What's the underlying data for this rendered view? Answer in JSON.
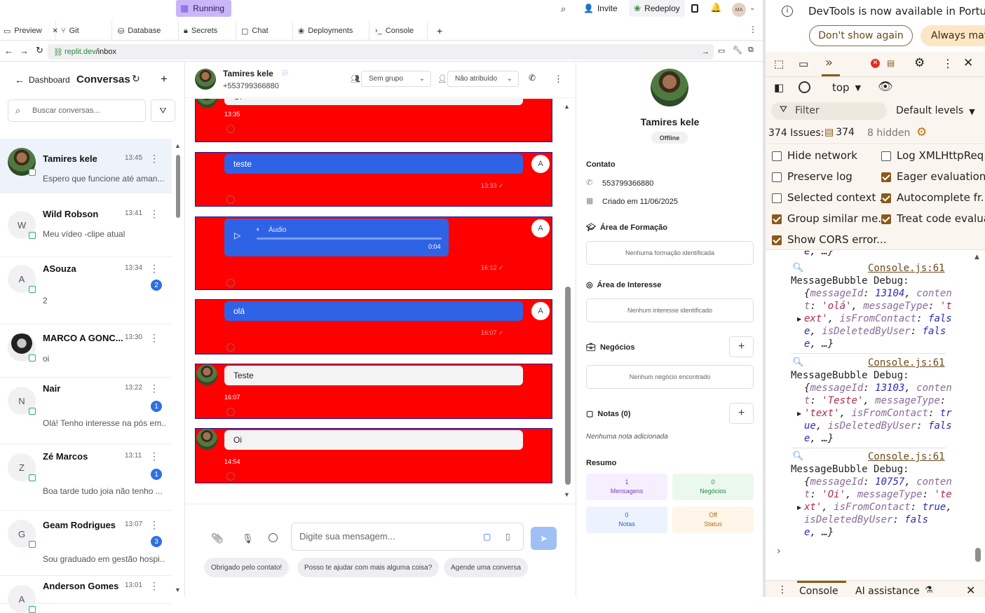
{
  "replit": {
    "status": "Running",
    "invite": "Invite",
    "redeploy": "Redeploy",
    "user_initials": "MA",
    "tabs": [
      "Preview",
      "Git",
      "Database",
      "Secrets",
      "Chat",
      "Deployments",
      "Console"
    ],
    "url_host": "replit.dev",
    "url_path": "/inbox"
  },
  "sidebar": {
    "back_label": "Dashboard",
    "title": "Conversas",
    "search_placeholder": "Buscar conversas...",
    "conversations": [
      {
        "name": "Tamires kele",
        "time": "13:45",
        "preview": "Espero que funcione até aman...",
        "avatar": "photo",
        "badge": ""
      },
      {
        "name": "Wild Robson",
        "time": "13:41",
        "preview": "Meu vídeo -clipe atual",
        "avatar": "W",
        "badge": ""
      },
      {
        "name": "ASouza",
        "time": "13:34",
        "preview": "2",
        "avatar": "A",
        "badge": "2"
      },
      {
        "name": "MARCO A GONC...",
        "time": "13:30",
        "preview": "oi",
        "avatar": "photo2",
        "badge": ""
      },
      {
        "name": "Nair",
        "time": "13:22",
        "preview": "Olá! Tenho interesse na pós em...",
        "avatar": "N",
        "badge": "1"
      },
      {
        "name": "Zé Marcos",
        "time": "13:11",
        "preview": "Boa tarde tudo joia não tenho ...",
        "avatar": "Z",
        "badge": "1"
      },
      {
        "name": "Geam Rodrigues",
        "time": "13:07",
        "preview": "Sou graduado em gestão hospi...",
        "avatar": "G",
        "badge": "3"
      },
      {
        "name": "Anderson Gomes",
        "time": "13:01",
        "preview": "",
        "avatar": "A",
        "badge": ""
      }
    ]
  },
  "chat": {
    "contact_name": "Tamires kele",
    "contact_phone": "+553799366880",
    "group_select": "Sem grupo",
    "assign_select": "Não atribuído",
    "messages": [
      {
        "text": "Oi",
        "time": "13:35"
      },
      {
        "text": "teste",
        "time": "13:33 ✓"
      },
      {
        "text": "Áudio",
        "duration": "0:04",
        "time": "16:12 ✓"
      },
      {
        "text": "olá",
        "time": "16:07 ✓"
      },
      {
        "text": "Teste",
        "time": "16:07"
      },
      {
        "text": "Oi",
        "time": "14:54"
      }
    ],
    "agent_initial": "A",
    "input_placeholder": "Digite sua mensagem...",
    "quick_replies": [
      "Obrigado pelo contato!",
      "Posso te ajudar com mais alguma coisa?",
      "Agende uma conversa"
    ]
  },
  "contact_panel": {
    "name": "Tamires kele",
    "status": "Offline",
    "contact_heading": "Contato",
    "phone": "553799366880",
    "created": "Criado em 11/06/2025",
    "formation_heading": "Área de Formação",
    "formation_empty": "Nenhuma formação identificada",
    "interest_heading": "Área de Interesse",
    "interest_empty": "Nenhum interesse identificado",
    "deals_heading": "Negócios",
    "deals_empty": "Nenhum negócio encontrado",
    "notes_heading": "Notas (0)",
    "notes_empty": "Nenhuma nota adicionada",
    "summary_heading": "Resumo",
    "stats": [
      {
        "value": "1",
        "label": "Mensagens",
        "color": "#7b3fbf",
        "bg": "#f6efff"
      },
      {
        "value": "0",
        "label": "Negócios",
        "color": "#2a8a3a",
        "bg": "#ebf8ee"
      },
      {
        "value": "0",
        "label": "Notas",
        "color": "#2f5fc0",
        "bg": "#ecf3ff"
      },
      {
        "value": "Off",
        "label": "Status",
        "color": "#c06a10",
        "bg": "#fff5e8"
      }
    ]
  },
  "devtools": {
    "banner": "DevTools is now available in Portug",
    "dont_show": "Don't show again",
    "always_match": "Always mat",
    "context": "top",
    "filter_placeholder": "Filter",
    "levels": "Default levels",
    "issues_count": "374 Issues:",
    "issues_icon_count": "374",
    "hidden": "8 hidden",
    "options": [
      {
        "label": "Hide network",
        "checked": false
      },
      {
        "label": "Log XMLHttpReq...",
        "checked": false
      },
      {
        "label": "Preserve log",
        "checked": false
      },
      {
        "label": "Eager evaluation",
        "checked": true
      },
      {
        "label": "Selected context ...",
        "checked": false
      },
      {
        "label": "Autocomplete fr...",
        "checked": true
      },
      {
        "label": "Group similar me...",
        "checked": true
      },
      {
        "label": "Treat code evalua...",
        "checked": true
      },
      {
        "label": "Show CORS error...",
        "checked": true
      }
    ],
    "logs": [
      {
        "source": "Console.js:61",
        "title": "MessageBubble Debug:",
        "lines": [
          {
            "k": "messageId",
            "v": "13104",
            "t": "num",
            "pre": "{",
            "post": ", conten"
          },
          {
            "raw": "t: 'olá', messageType: 't"
          },
          {
            "raw": "ext', isFromContact: fals"
          },
          {
            "raw": "e, isDeletedByUser: fals"
          },
          {
            "raw": "e, …}"
          }
        ]
      },
      {
        "source": "Console.js:61",
        "title": "MessageBubble Debug:",
        "lines": [
          {
            "raw": "{messageId: 13103, conten"
          },
          {
            "raw": "t: 'Teste', messageType:"
          },
          {
            "raw": "'text', isFromContact: tr"
          },
          {
            "raw": "ue, isDeletedByUser: fals"
          },
          {
            "raw": "e, …}"
          }
        ]
      },
      {
        "source": "Console.js:61",
        "title": "MessageBubble Debug:",
        "lines": [
          {
            "raw": "{messageId: 10757, conten"
          },
          {
            "raw": "t: 'Oi', messageType: 'te"
          },
          {
            "raw": "xt', isFromContact: true,"
          },
          {
            "raw": "isDeletedByUser: fals"
          },
          {
            "raw": "e, …}"
          }
        ]
      }
    ],
    "drawer_tabs": [
      "Console",
      "AI assistance"
    ]
  }
}
